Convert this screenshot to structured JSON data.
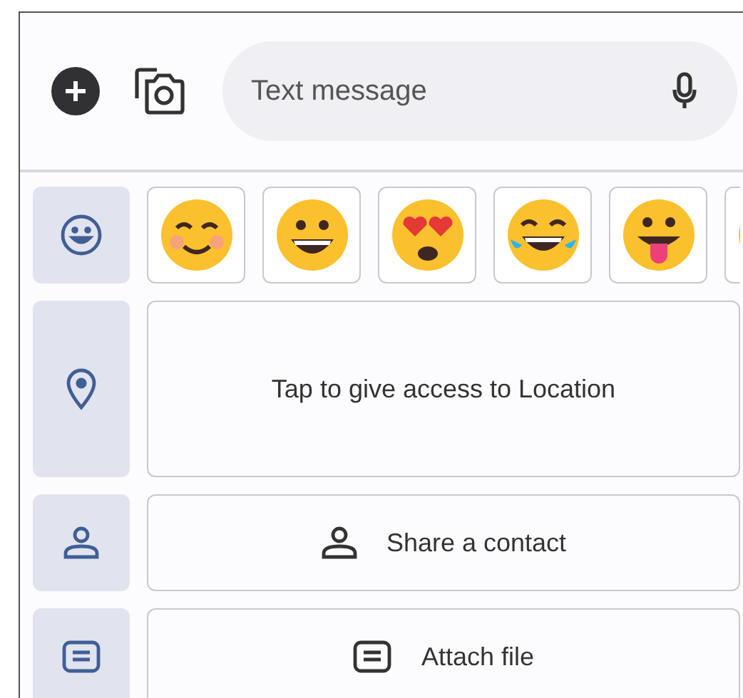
{
  "compose": {
    "placeholder": "Text message"
  },
  "location_card": {
    "text": "Tap to give access to Location"
  },
  "contact_card": {
    "text": "Share a contact"
  },
  "file_card": {
    "text": "Attach file"
  }
}
